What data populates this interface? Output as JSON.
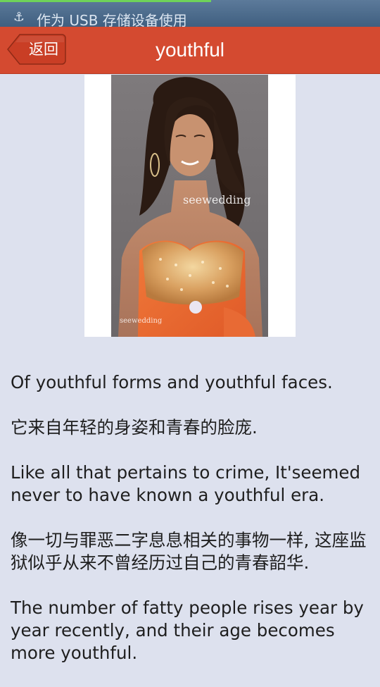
{
  "status_bar": {
    "notification": "作为 USB 存储设备使用",
    "icon": "usb-anchor-icon"
  },
  "header": {
    "back_label": "返回",
    "title": "youthful"
  },
  "image": {
    "watermark": "seewedding",
    "corner_mark": "seewedding"
  },
  "sentences": [
    "Of youthful forms and youthful faces.",
    "它来自年轻的身姿和青春的脸庞.",
    "Like all that pertains to crime, It'seemed never to have known a youthful era.",
    "像一切与罪恶二字息息相关的事物一样, 这座监狱似乎从来不曾经历过自己的青春韶华.",
    "The number of fatty people rises year by year recently, and their age becomes more youthful."
  ],
  "colors": {
    "header_bg": "#d44a30",
    "page_bg": "#dde1ee",
    "status_bg": "#3f5f80"
  }
}
